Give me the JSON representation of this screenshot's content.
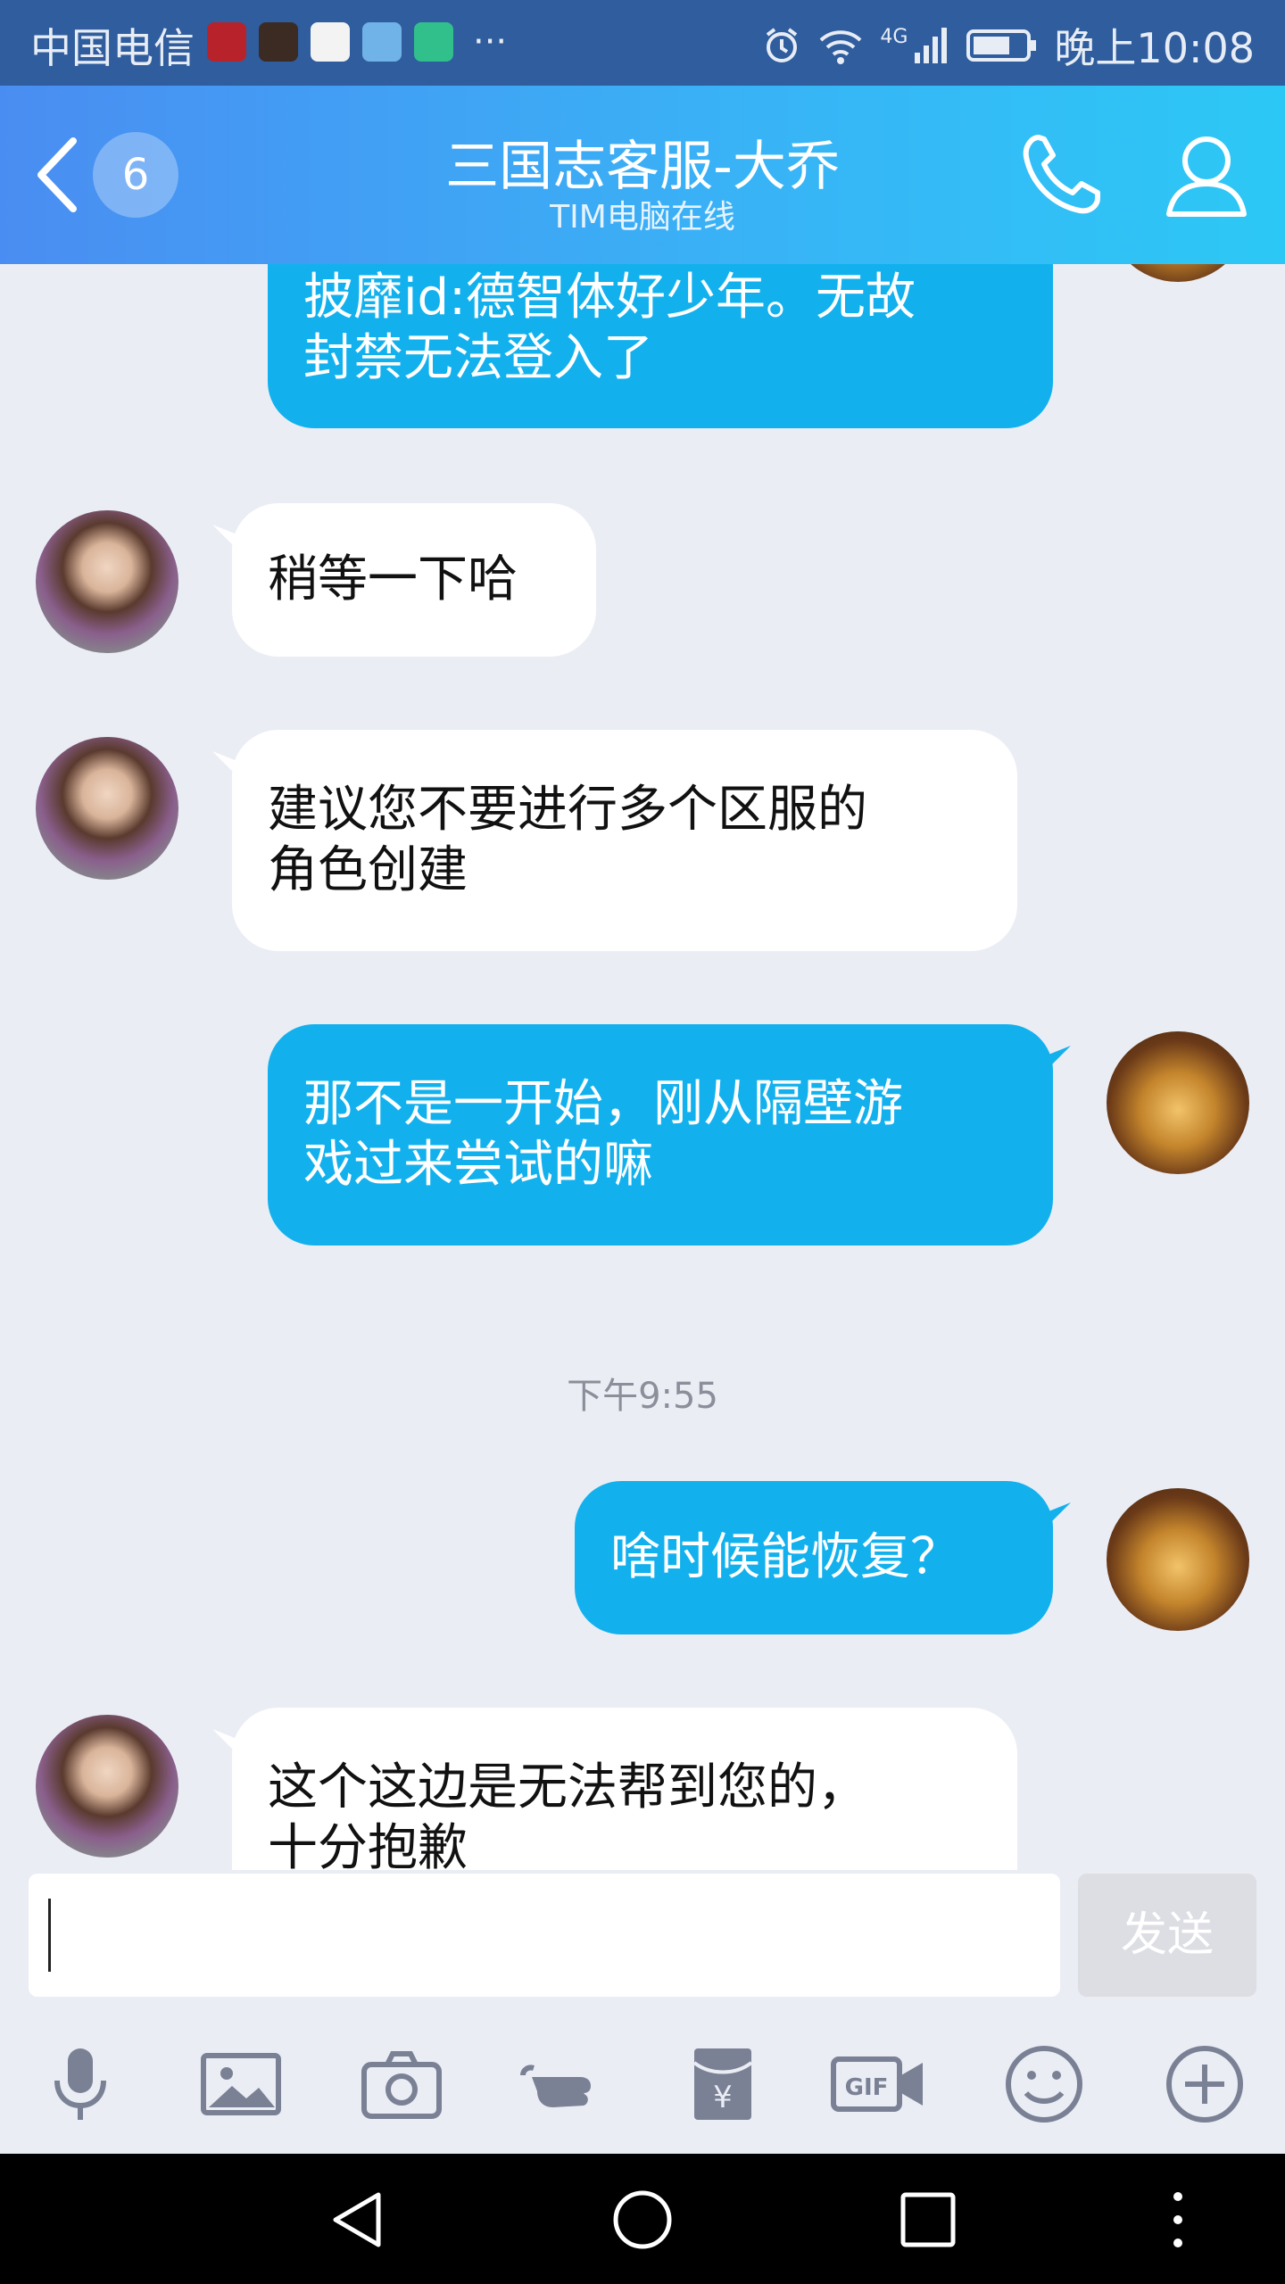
{
  "status_bar": {
    "carrier": "中国电信",
    "time": "晚上10:08",
    "network": "4G",
    "more": "···"
  },
  "header": {
    "title": "三国志客服-大乔",
    "subtitle": "TIM电脑在线",
    "badge_count": "6"
  },
  "messages": [
    {
      "side": "out",
      "text": "披靡id:德智体好少年。无故\n封禁无法登入了"
    },
    {
      "side": "in",
      "text": "稍等一下哈"
    },
    {
      "side": "in",
      "text": "建议您不要进行多个区服的\n角色创建"
    },
    {
      "side": "out",
      "text": "那不是一开始，刚从隔壁游\n戏过来尝试的嘛"
    },
    {
      "side": "time",
      "text": "下午9:55"
    },
    {
      "side": "out",
      "text": "啥时候能恢复？"
    },
    {
      "side": "in",
      "text": "这个这边是无法帮到您的，\n十分抱歉"
    }
  ],
  "composer": {
    "input_value": "",
    "send_label": "发送"
  },
  "toolbar_icons": [
    "microphone-icon",
    "image-icon",
    "camera-icon",
    "poke-icon",
    "red-packet-icon",
    "gif-icon",
    "emoji-icon",
    "plus-icon"
  ],
  "colors": {
    "header_start": "#4a8df2",
    "header_end": "#2cc8f5",
    "bubble_out": "#12b1ee",
    "bubble_in": "#ffffff",
    "background": "#ebedf5"
  }
}
